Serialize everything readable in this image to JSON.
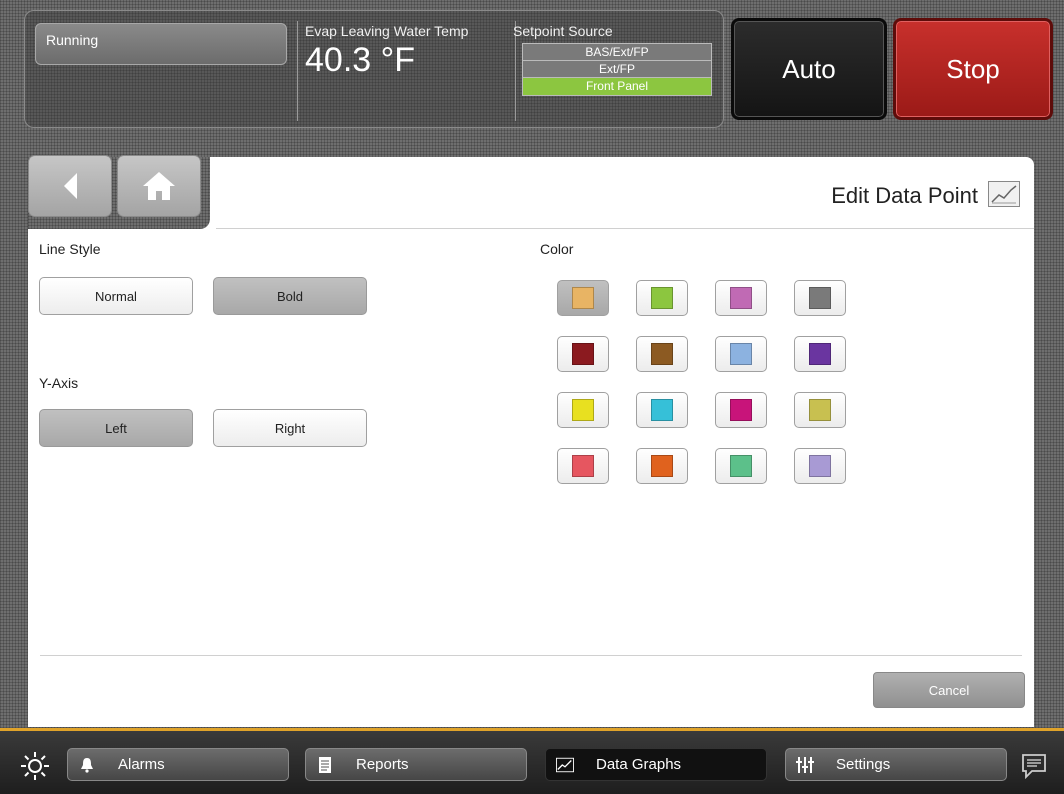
{
  "status": {
    "running": "Running",
    "evap_label": "Evap Leaving Water Temp",
    "evap_value": "40.3 °F",
    "setpoint_label": "Setpoint Source",
    "setpoint_options": [
      "BAS/Ext/FP",
      "Ext/FP",
      "Front Panel"
    ],
    "active_setpoint": "Front Panel",
    "auto_label": "Auto",
    "stop_label": "Stop"
  },
  "page": {
    "title": "Edit Data Point"
  },
  "line_style": {
    "label": "Line Style",
    "options": [
      "Normal",
      "Bold"
    ],
    "selected": "Bold"
  },
  "y_axis": {
    "label": "Y-Axis",
    "options": [
      "Left",
      "Right"
    ],
    "selected": "Left"
  },
  "color": {
    "label": "Color",
    "swatches": [
      "#e8b464",
      "#8cc63f",
      "#c06ab4",
      "#7a7a7a",
      "#8b1a1f",
      "#8c5a22",
      "#8cb2e0",
      "#6a35a0",
      "#e8e020",
      "#36c0d8",
      "#c8147a",
      "#c8c050",
      "#e65660",
      "#e0621e",
      "#5cc08a",
      "#a89ad4"
    ],
    "selected_index": 0
  },
  "actions": {
    "cancel": "Cancel"
  },
  "bottom_nav": {
    "alarms": "Alarms",
    "reports": "Reports",
    "data_graphs": "Data Graphs",
    "settings": "Settings"
  }
}
